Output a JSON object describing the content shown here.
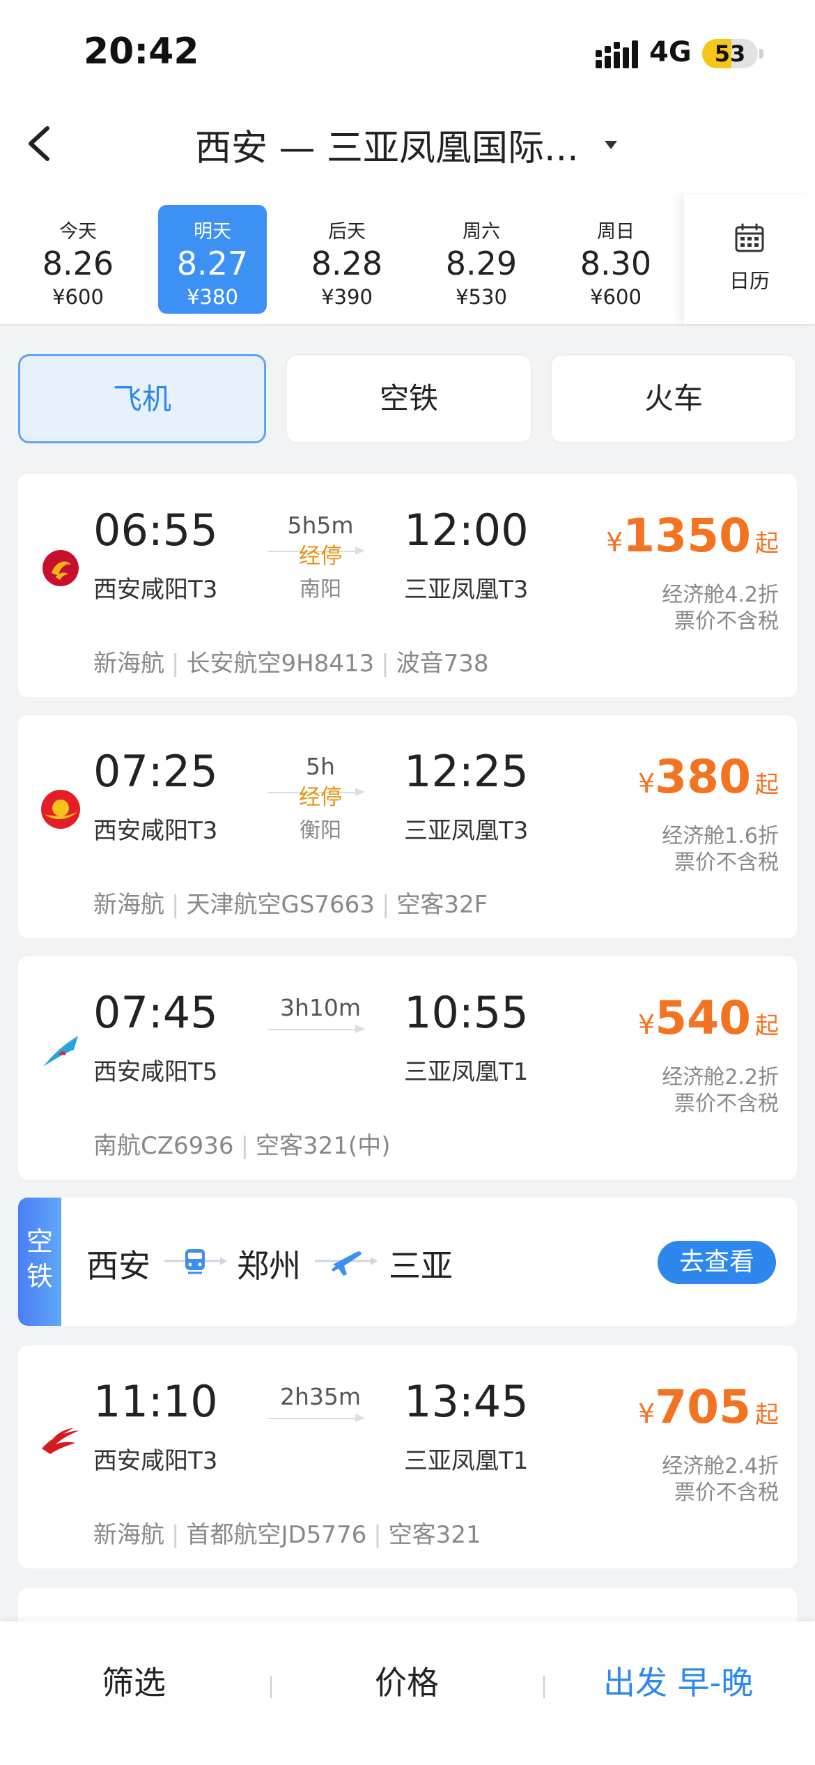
{
  "status": {
    "time": "20:42",
    "network": "4G",
    "battery": "53",
    "battery_level": 0.53
  },
  "header": {
    "title": "西安 — 三亚凤凰国际..."
  },
  "dates": [
    {
      "label": "今天",
      "date": "8.26",
      "price": "¥600",
      "selected": false
    },
    {
      "label": "明天",
      "date": "8.27",
      "price": "¥380",
      "selected": true
    },
    {
      "label": "后天",
      "date": "8.28",
      "price": "¥390",
      "selected": false
    },
    {
      "label": "周六",
      "date": "8.29",
      "price": "¥530",
      "selected": false
    },
    {
      "label": "周日",
      "date": "8.30",
      "price": "¥600",
      "selected": false
    }
  ],
  "calendar_label": "日历",
  "tabs": [
    "飞机",
    "空铁",
    "火车"
  ],
  "flights": [
    {
      "dep_time": "06:55",
      "arr_time": "12:00",
      "duration": "5h5m",
      "stop": "经停",
      "stop_city": "南阳",
      "dep_airport": "西安咸阳T3",
      "arr_airport": "三亚凤凰T3",
      "currency": "¥",
      "price": "1350",
      "suffix": "起",
      "cabin": "经济舱4.2折",
      "tax": "票价不含税",
      "seller": "新海航",
      "flight_no": "长安航空9H8413",
      "aircraft": "波音738"
    },
    {
      "dep_time": "07:25",
      "arr_time": "12:25",
      "duration": "5h",
      "stop": "经停",
      "stop_city": "衡阳",
      "dep_airport": "西安咸阳T3",
      "arr_airport": "三亚凤凰T3",
      "currency": "¥",
      "price": "380",
      "suffix": "起",
      "cabin": "经济舱1.6折",
      "tax": "票价不含税",
      "seller": "新海航",
      "flight_no": "天津航空GS7663",
      "aircraft": "空客32F"
    },
    {
      "dep_time": "07:45",
      "arr_time": "10:55",
      "duration": "3h10m",
      "dep_airport": "西安咸阳T5",
      "arr_airport": "三亚凤凰T1",
      "currency": "¥",
      "price": "540",
      "suffix": "起",
      "cabin": "经济舱2.2折",
      "tax": "票价不含税",
      "flight_no": "南航CZ6936",
      "aircraft": "空客321(中)"
    },
    {
      "dep_time": "11:10",
      "arr_time": "13:45",
      "duration": "2h35m",
      "dep_airport": "西安咸阳T3",
      "arr_airport": "三亚凤凰T1",
      "currency": "¥",
      "price": "705",
      "suffix": "起",
      "cabin": "经济舱2.4折",
      "tax": "票价不含税",
      "seller": "新海航",
      "flight_no": "首都航空JD5776",
      "aircraft": "空客321"
    }
  ],
  "rail_banner": {
    "tag": "空铁",
    "from": "西安",
    "via": "郑州",
    "to": "三亚",
    "button": "去查看"
  },
  "bottom_bar": {
    "filter": "筛选",
    "price": "价格",
    "sort": "出发 早-晚"
  },
  "colors": {
    "accent": "#2d87ec",
    "price": "#f37321",
    "stop": "#e8920e",
    "selected_date": "#3d91f5"
  }
}
